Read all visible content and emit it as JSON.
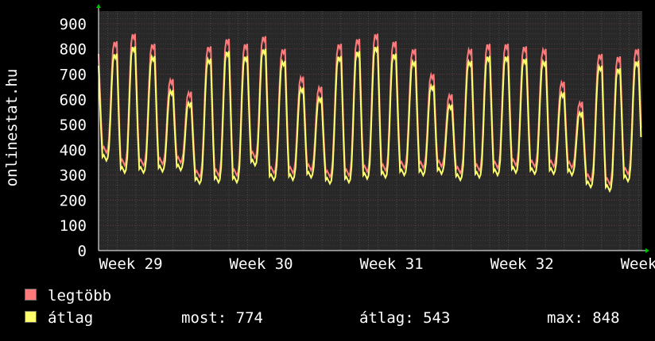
{
  "chart_data": {
    "type": "line",
    "title": "",
    "ylabel": "onlinestat.hu",
    "xlabel": "",
    "ylim": [
      0,
      950
    ],
    "yticks": [
      0,
      100,
      200,
      300,
      400,
      500,
      600,
      700,
      800,
      900
    ],
    "xticks": [
      "Week 29",
      "Week 30",
      "Week 31",
      "Week 32",
      "Week 33"
    ],
    "xticks_pos": [
      0,
      1,
      2,
      3,
      4
    ],
    "xlim": [
      -0.07,
      4.1
    ],
    "grid": true,
    "background": "#282828",
    "legend_position": "bottom-left",
    "days": [
      {
        "d": -0.07,
        "peak": 780,
        "low": 400
      },
      {
        "d": 0.07,
        "peak": 830,
        "low": 350
      },
      {
        "d": 0.21,
        "peak": 860,
        "low": 350
      },
      {
        "d": 0.36,
        "peak": 820,
        "low": 355
      },
      {
        "d": 0.5,
        "peak": 680,
        "low": 360
      },
      {
        "d": 0.64,
        "peak": 630,
        "low": 305
      },
      {
        "d": 0.79,
        "peak": 810,
        "low": 310
      },
      {
        "d": 0.93,
        "peak": 840,
        "low": 310
      },
      {
        "d": 1.07,
        "peak": 820,
        "low": 380
      },
      {
        "d": 1.21,
        "peak": 850,
        "low": 320
      },
      {
        "d": 1.36,
        "peak": 800,
        "low": 320
      },
      {
        "d": 1.5,
        "peak": 690,
        "low": 330
      },
      {
        "d": 1.64,
        "peak": 650,
        "low": 305
      },
      {
        "d": 1.79,
        "peak": 820,
        "low": 310
      },
      {
        "d": 1.93,
        "peak": 840,
        "low": 325
      },
      {
        "d": 2.07,
        "peak": 860,
        "low": 330
      },
      {
        "d": 2.21,
        "peak": 830,
        "low": 340
      },
      {
        "d": 2.36,
        "peak": 800,
        "low": 340
      },
      {
        "d": 2.5,
        "peak": 700,
        "low": 345
      },
      {
        "d": 2.64,
        "peak": 620,
        "low": 320
      },
      {
        "d": 2.79,
        "peak": 800,
        "low": 330
      },
      {
        "d": 2.93,
        "peak": 820,
        "low": 340
      },
      {
        "d": 3.07,
        "peak": 820,
        "low": 350
      },
      {
        "d": 3.21,
        "peak": 810,
        "low": 345
      },
      {
        "d": 3.36,
        "peak": 800,
        "low": 345
      },
      {
        "d": 3.5,
        "peak": 670,
        "low": 340
      },
      {
        "d": 3.64,
        "peak": 590,
        "low": 290
      },
      {
        "d": 3.79,
        "peak": 780,
        "low": 275
      },
      {
        "d": 3.93,
        "peak": 770,
        "low": 315
      },
      {
        "d": 4.07,
        "peak": 800,
        "low": 360
      }
    ],
    "series": [
      {
        "name": "legtöbb",
        "color": "#ff7b7b"
      },
      {
        "name": "átlag",
        "color": "#ffff6e"
      }
    ]
  },
  "legend": {
    "max_label": "legtöbb",
    "avg_label": "átlag"
  },
  "stats": {
    "now": "most: 774",
    "avg": "átlag: 543",
    "max": "max: 848"
  }
}
